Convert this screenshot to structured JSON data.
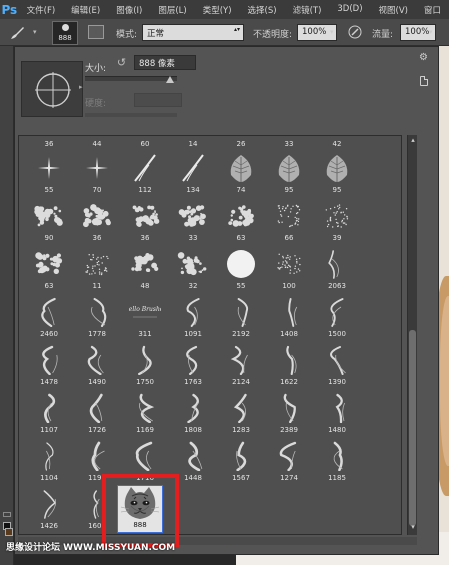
{
  "menubar": {
    "app_logo": "Ps",
    "items": [
      "文件(F)",
      "编辑(E)",
      "图像(I)",
      "图层(L)",
      "类型(Y)",
      "选择(S)",
      "滤镜(T)",
      "3D(D)",
      "视图(V)",
      "窗口"
    ]
  },
  "options_bar": {
    "brush_size": "888",
    "mode_label": "模式:",
    "mode_value": "正常",
    "opacity_label": "不透明度:",
    "opacity_value": "100%",
    "flow_label": "流量:",
    "flow_value": "100%"
  },
  "picker": {
    "size_label": "大小:",
    "size_value": "888 像素",
    "hardness_label": "硬度:",
    "header_row": [
      "36",
      "44",
      "60",
      "14",
      "26",
      "33",
      "42"
    ],
    "rows": [
      {
        "labels": [
          "55",
          "70",
          "112",
          "134",
          "74",
          "95",
          "95"
        ],
        "icons": [
          "star-brush",
          "star-brush",
          "grass-brush",
          "grass-brush",
          "leaf-brush",
          "leaf-brush",
          "leaf-brush"
        ]
      },
      {
        "labels": [
          "90",
          "36",
          "36",
          "33",
          "63",
          "66",
          "39"
        ],
        "icons": [
          "texture-brush",
          "texture-brush",
          "texture-brush",
          "texture-brush",
          "texture-brush",
          "spray-brush",
          "spray-brush"
        ]
      },
      {
        "labels": [
          "63",
          "11",
          "48",
          "32",
          "55",
          "100",
          "2063"
        ],
        "icons": [
          "texture-brush",
          "spray-brush",
          "texture-brush",
          "texture-brush",
          "round-brush",
          "spray-brush",
          "smoke-brush"
        ]
      },
      {
        "labels": [
          "2460",
          "1778",
          "311",
          "1091",
          "2192",
          "1408",
          "1500"
        ],
        "icons": [
          "smoke-brush",
          "smoke-brush",
          "script-brush",
          "smoke-brush",
          "smoke-brush",
          "smoke-brush",
          "smoke-brush"
        ]
      },
      {
        "labels": [
          "1478",
          "1490",
          "1750",
          "1763",
          "2124",
          "1622",
          "1390"
        ],
        "icons": [
          "smoke-brush",
          "smoke-brush",
          "smoke-brush",
          "smoke-brush",
          "smoke-brush",
          "smoke-brush",
          "smoke-brush"
        ]
      },
      {
        "labels": [
          "1107",
          "1726",
          "1169",
          "1808",
          "1283",
          "2389",
          "1480"
        ],
        "icons": [
          "smoke-brush",
          "smoke-brush",
          "smoke-brush",
          "smoke-brush",
          "smoke-brush",
          "smoke-brush",
          "smoke-brush"
        ]
      },
      {
        "labels": [
          "1104",
          "1192",
          "1716",
          "1448",
          "1567",
          "1274",
          "1185"
        ],
        "icons": [
          "smoke-brush",
          "smoke-brush",
          "smoke-brush",
          "smoke-brush",
          "smoke-brush",
          "smoke-brush",
          "smoke-brush"
        ]
      },
      {
        "labels": [
          "1426",
          "1606",
          "888"
        ],
        "icons": [
          "smoke-brush",
          "smoke-brush",
          "cat-face-brush"
        ]
      }
    ],
    "script_text": "Hello Brushes"
  },
  "highlight_color": "#e41e1e",
  "watermark": "思缘设计论坛 WWW.MISSYUAN.COM"
}
